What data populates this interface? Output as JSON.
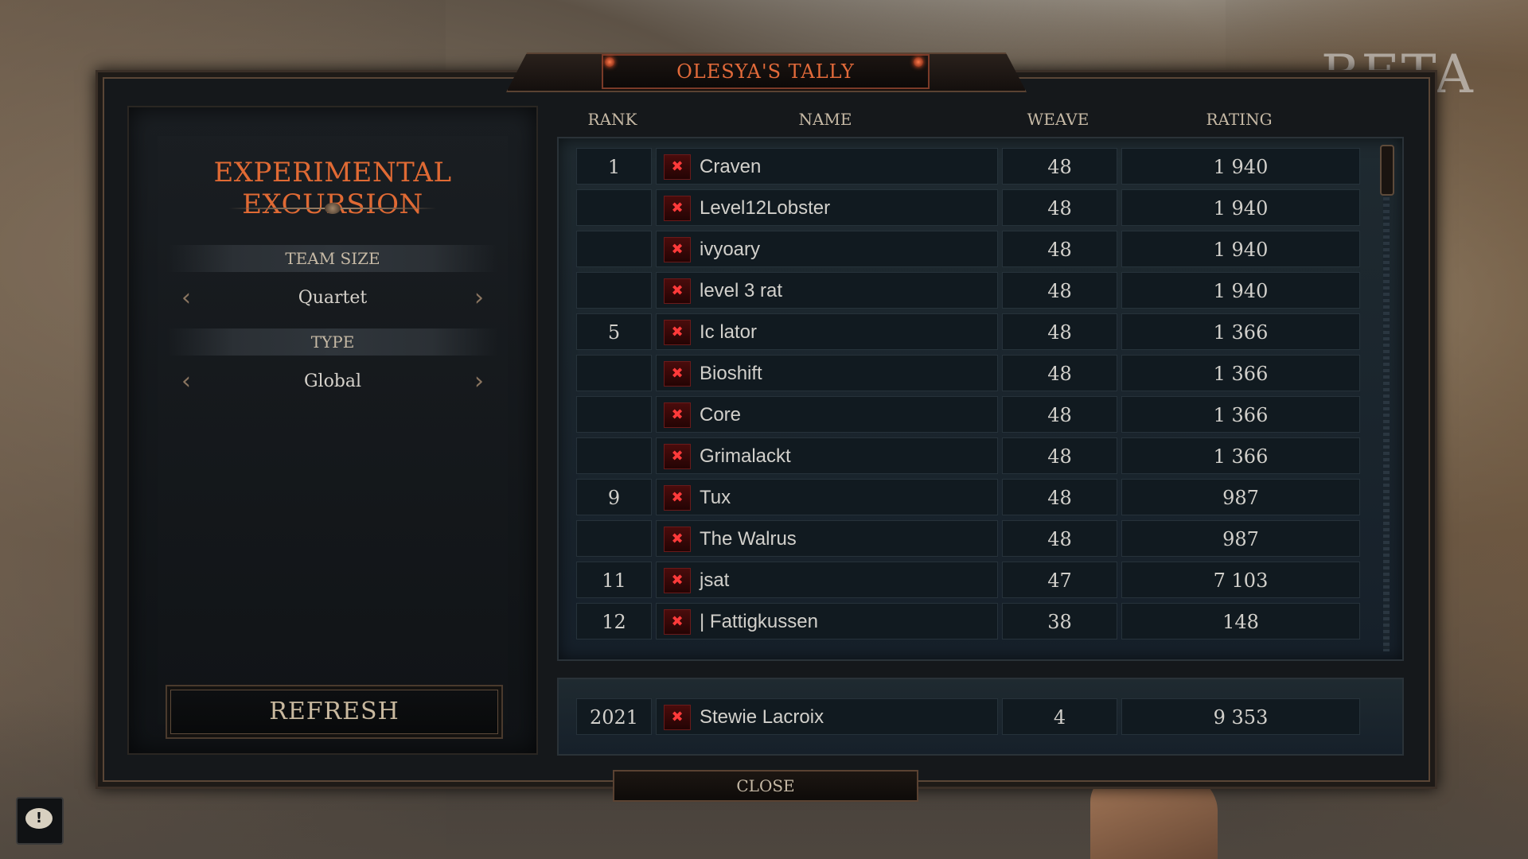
{
  "watermark": "BETA",
  "window": {
    "title": "OLESYA'S TALLY",
    "close_label": "CLOSE"
  },
  "left_panel": {
    "mode_title": "EXPERIMENTAL EXCURSION",
    "team_size": {
      "label": "TEAM SIZE",
      "value": "Quartet"
    },
    "type": {
      "label": "TYPE",
      "value": "Global"
    },
    "refresh_label": "REFRESH"
  },
  "table": {
    "columns": {
      "rank": "RANK",
      "name": "NAME",
      "weave": "WEAVE",
      "rating": "RATING"
    },
    "rows": [
      {
        "rank": "1",
        "name": "Craven",
        "weave": "48",
        "rating": "1 940"
      },
      {
        "rank": "",
        "name": "Level12Lobster",
        "weave": "48",
        "rating": "1 940"
      },
      {
        "rank": "",
        "name": "ivyoary",
        "weave": "48",
        "rating": "1 940"
      },
      {
        "rank": "",
        "name": "level 3 rat",
        "weave": "48",
        "rating": "1 940"
      },
      {
        "rank": "5",
        "name": "Ic  lator",
        "weave": "48",
        "rating": "1 366"
      },
      {
        "rank": "",
        "name": "Bioshift",
        "weave": "48",
        "rating": "1 366"
      },
      {
        "rank": "",
        "name": "Core",
        "weave": "48",
        "rating": "1 366"
      },
      {
        "rank": "",
        "name": "Grimalackt",
        "weave": "48",
        "rating": "1 366"
      },
      {
        "rank": "9",
        "name": "Tux",
        "weave": "48",
        "rating": "987"
      },
      {
        "rank": "",
        "name": "The Walrus",
        "weave": "48",
        "rating": "987"
      },
      {
        "rank": "11",
        "name": "jsat",
        "weave": "47",
        "rating": "7 103"
      },
      {
        "rank": "12",
        "name": "  | Fattigkussen",
        "weave": "38",
        "rating": "148"
      }
    ],
    "player": {
      "rank": "2021",
      "name": "Stewie Lacroix",
      "weave": "4",
      "rating": "9 353"
    }
  },
  "icons": {
    "platform_badge": "x-badge-icon",
    "prev": "chevron-left-icon",
    "next": "chevron-right-icon",
    "chat": "chat-bubble-icon"
  },
  "colors": {
    "accent": "#e06a34",
    "badge": "#ff3a3a"
  }
}
